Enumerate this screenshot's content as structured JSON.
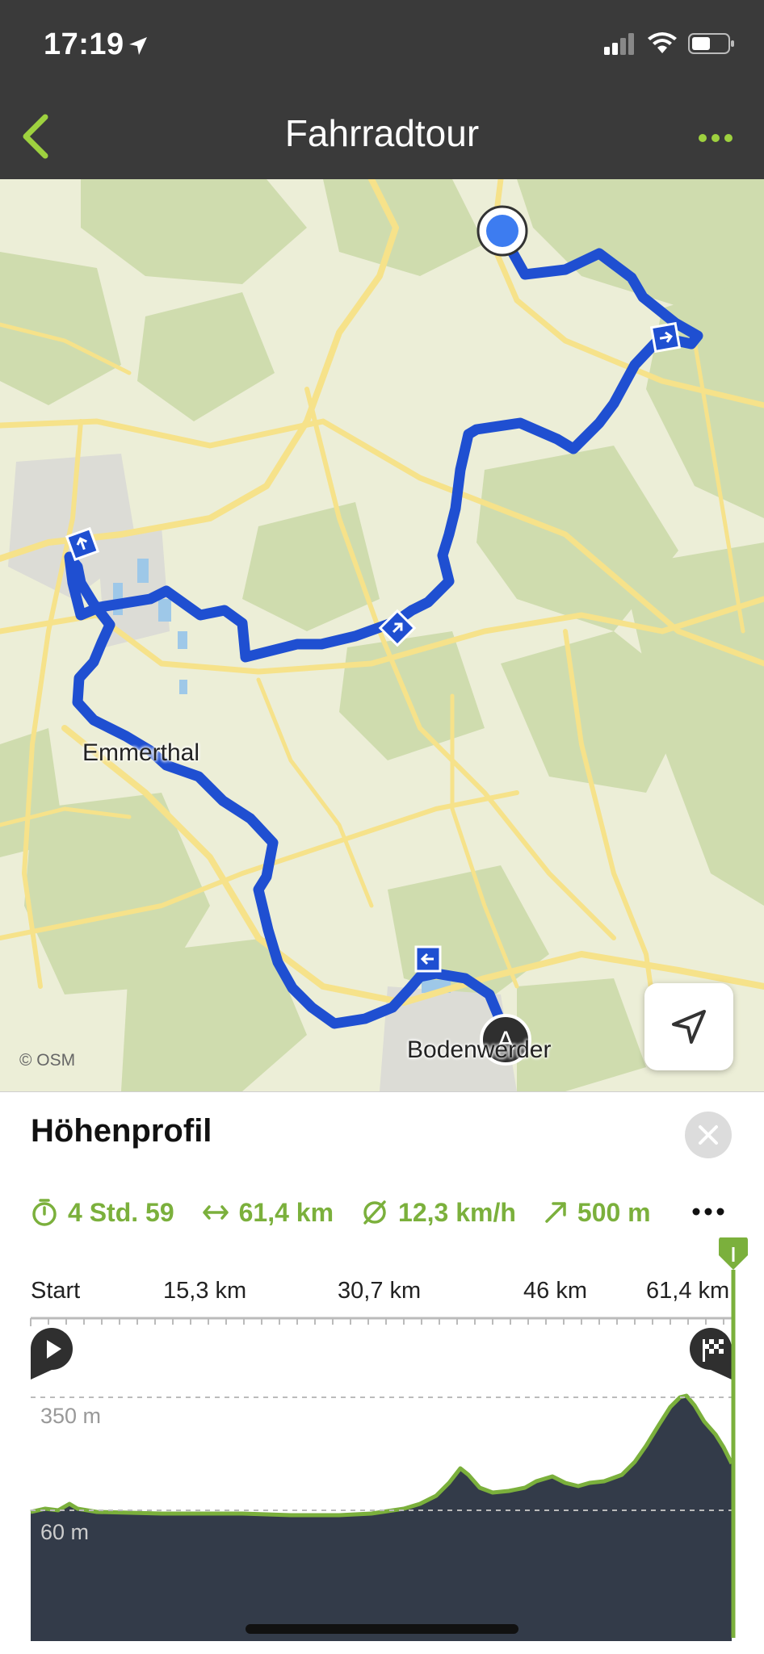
{
  "status_bar": {
    "time": "17:19"
  },
  "nav": {
    "title": "Fahrradtour"
  },
  "map": {
    "attribution": "© OSM",
    "place_labels": [
      "Emmerthal",
      "Bodenwerder"
    ],
    "route_color": "#1f4fd1",
    "start_marker_label": "A"
  },
  "profile": {
    "title": "Höhenprofil",
    "stats": {
      "duration": "4 Std. 59",
      "distance": "61,4 km",
      "avg_speed": "12,3 km/h",
      "ascent": "500 m"
    },
    "axis_labels": [
      "Start",
      "15,3 km",
      "30,7 km",
      "46 km",
      "61,4 km"
    ],
    "elevation_labels": [
      "350 m",
      "60 m"
    ],
    "accent_color": "#7bb03c"
  }
}
